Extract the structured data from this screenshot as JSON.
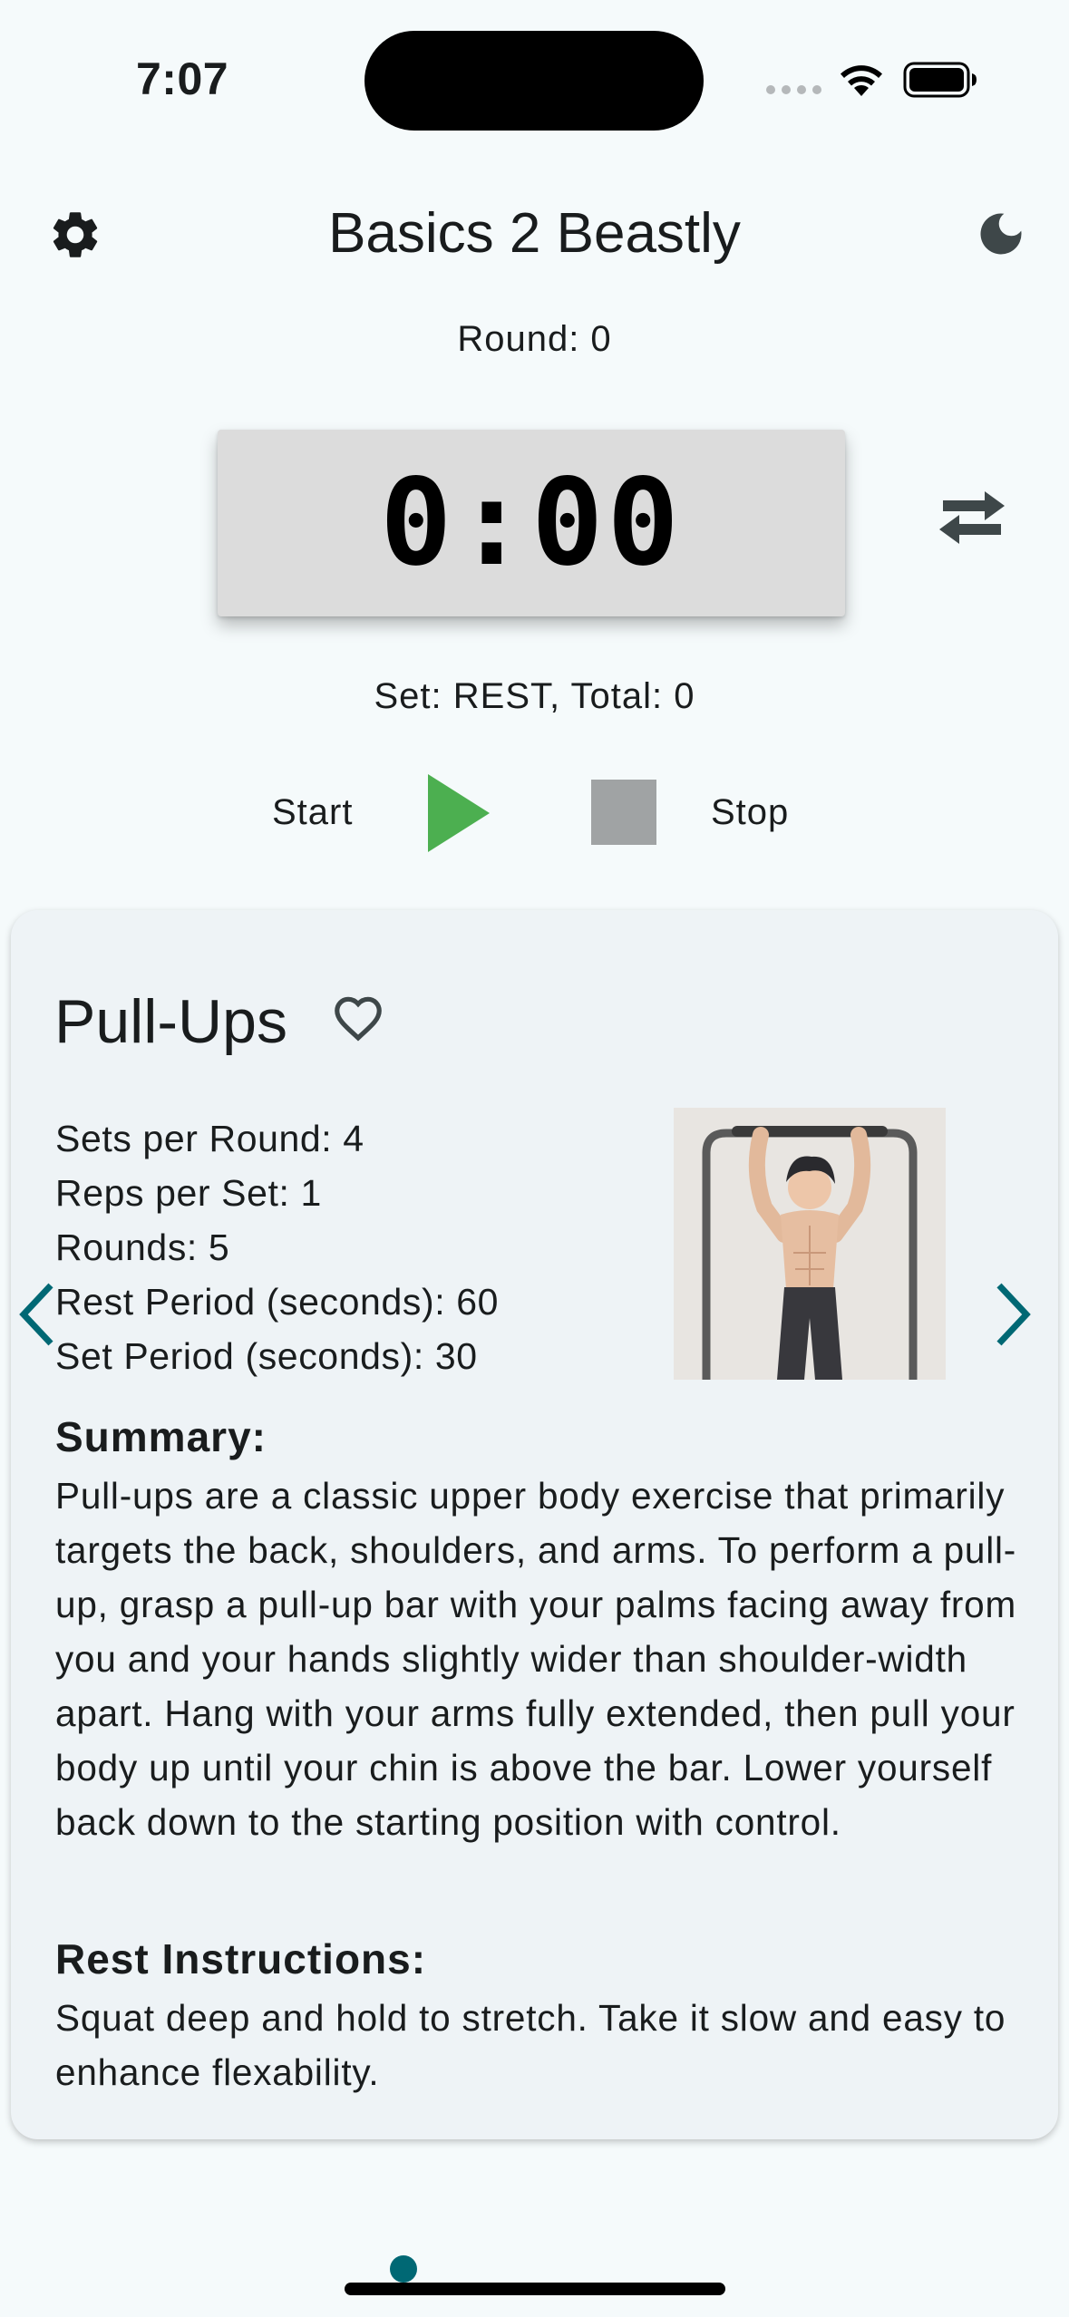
{
  "status_bar": {
    "time": "7:07"
  },
  "header": {
    "title": "Basics 2 Beastly",
    "settings_icon": "gear-icon",
    "theme_icon": "moon-icon"
  },
  "timer": {
    "round_label": "Round: 0",
    "display": "0:00",
    "set_label": "Set: REST, Total: 0",
    "start_label": "Start",
    "stop_label": "Stop"
  },
  "exercise": {
    "name": "Pull-Ups",
    "stats": [
      "Sets per Round: 4",
      "Reps per Set: 1",
      "Rounds: 5",
      "Rest Period (seconds): 60",
      "Set Period (seconds): 30"
    ],
    "summary_heading": "Summary:",
    "summary_text": "Pull-ups are a classic upper body exercise that primarily targets the back, shoulders, and arms. To perform a pull-up, grasp a pull-up bar with your palms facing away from you and your hands slightly wider than shoulder-width apart. Hang with your arms fully extended, then pull your body up until your chin is above the bar. Lower yourself back down to the starting position with control.",
    "rest_heading": "Rest Instructions:",
    "rest_text": "Squat deep and hold to stretch. Take it slow and easy to enhance flexability."
  },
  "colors": {
    "accent": "#006874",
    "play": "#4caf50",
    "stop": "#a0a3a4",
    "background": "#f5fafb",
    "card": "#eef3f6"
  }
}
